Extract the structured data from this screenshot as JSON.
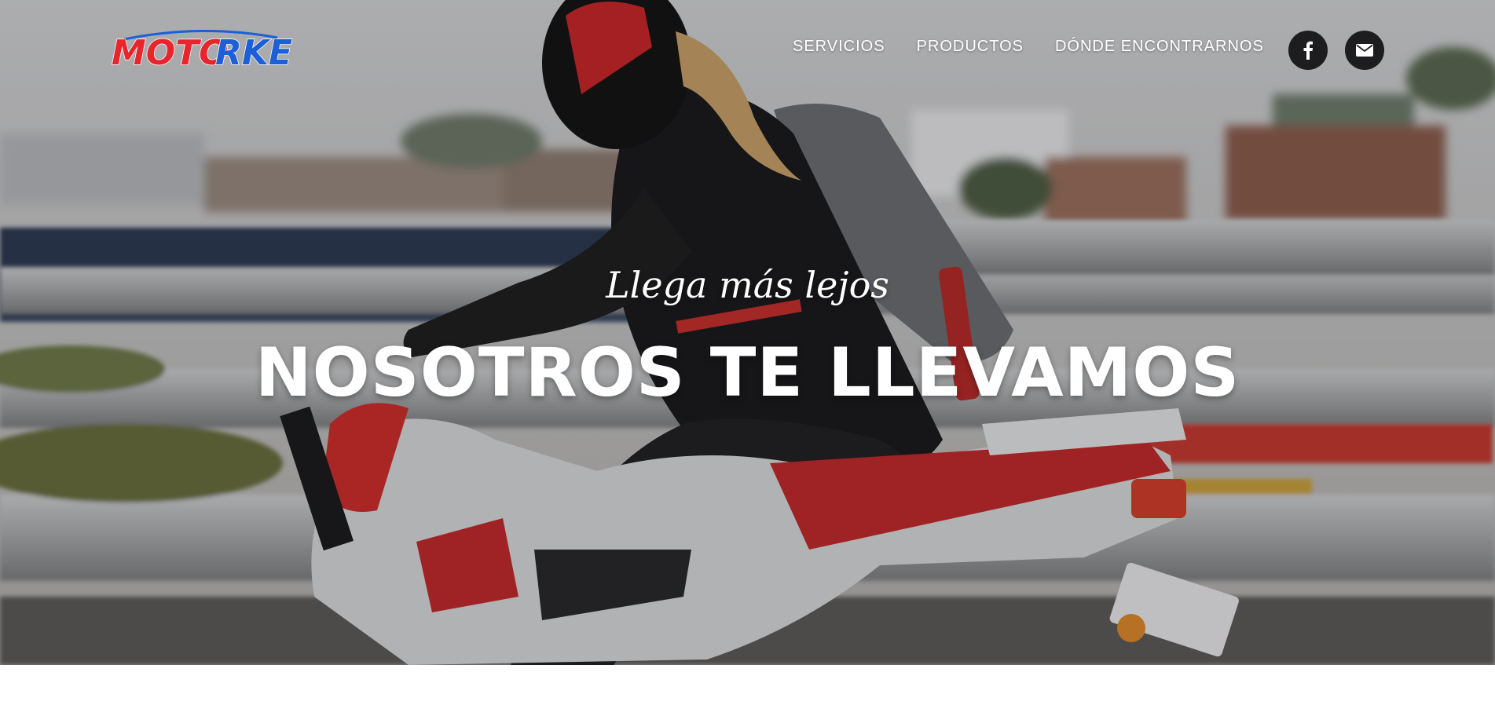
{
  "brand": {
    "logo_text_part1": "MOTO",
    "logo_text_part2": "RKE",
    "primary_color": "#e8242c",
    "secondary_color": "#1d5fd6"
  },
  "nav": {
    "items": [
      {
        "label": "SERVICIOS"
      },
      {
        "label": "PRODUCTOS"
      },
      {
        "label": "DÓNDE ENCONTRARNOS"
      }
    ]
  },
  "social": {
    "facebook_icon": "facebook-icon",
    "email_icon": "envelope-icon",
    "button_color": "#1d1d1f"
  },
  "hero": {
    "tagline": "Llega más lejos",
    "headline": "NOSOTROS TE LLEVAMOS"
  }
}
